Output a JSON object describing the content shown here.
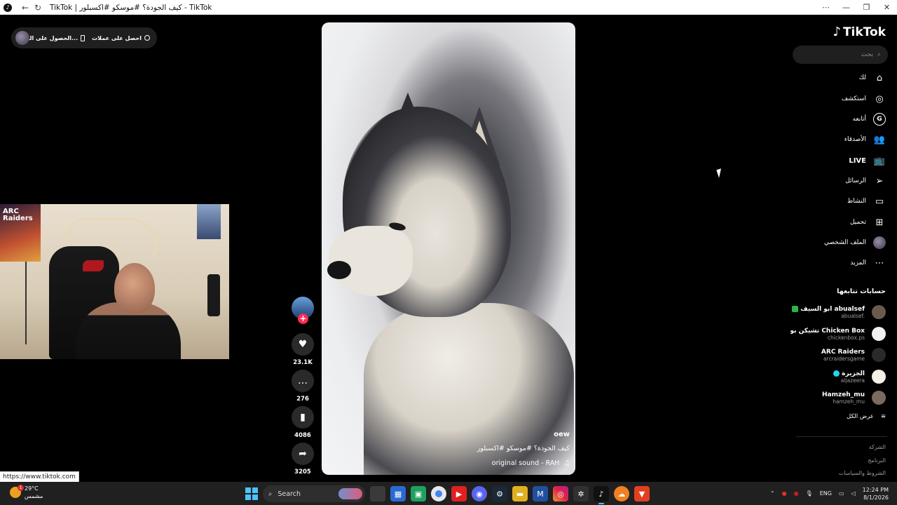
{
  "titlebar": {
    "title": "TikTok | كيف الجودة؟ #موسكو #اكسبلور - TikTok",
    "back_icon": "←",
    "reload_icon": "↻",
    "win_buttons": [
      "⋯",
      "—",
      "❐",
      "✕"
    ]
  },
  "coins_pill": {
    "get_coins": "احصل على عملات",
    "get_app": "الحصول على الت..."
  },
  "logo": {
    "text": "TikTok"
  },
  "search": {
    "placeholder": "بحث"
  },
  "nav": [
    {
      "label": "لك",
      "icon": "home-icon"
    },
    {
      "label": "استكشف",
      "icon": "compass-icon"
    },
    {
      "label": "أتابعه",
      "icon": "following-badge-icon"
    },
    {
      "label": "الأصدقاء",
      "icon": "friends-icon"
    },
    {
      "label": "LIVE",
      "icon": "live-tv-icon"
    },
    {
      "label": "الرسائل",
      "icon": "send-icon"
    },
    {
      "label": "النشاط",
      "icon": "activity-icon"
    },
    {
      "label": "تحميل",
      "icon": "upload-icon"
    },
    {
      "label": "الملف الشخصي",
      "icon": "profile-avatar"
    },
    {
      "label": "المزيد",
      "icon": "more-icon"
    }
  ],
  "following": {
    "title": "حسابات تتابعها",
    "accounts": [
      {
        "name": "ابو السيف abualsef",
        "handle": "abualsef.",
        "verified": "green",
        "avatar_color": "#6a5a50"
      },
      {
        "name": "تشيكن بوكس Chicken Box",
        "handle": "chickenbox.ps",
        "verified": "",
        "avatar_color": "#f2f2f2"
      },
      {
        "name": "ARC Raiders",
        "handle": "arcraidersgame",
        "verified": "",
        "avatar_color": "#2a2a2a"
      },
      {
        "name": "الجزيرة",
        "handle": "aljazeera",
        "verified": "blue",
        "avatar_color": "#f5f0e6"
      },
      {
        "name": "Hamzeh_mu",
        "handle": "hamzeh_mu",
        "verified": "",
        "avatar_color": "#7a6a60"
      }
    ],
    "see_all": "عرض الكل"
  },
  "footer_links": [
    "الشركة",
    "البرنامج",
    "الشروط والسياسات"
  ],
  "video": {
    "username": "oew",
    "caption": "كيف الجودة؟ #موسكو #اكسبلور",
    "sound": "original sound - RAH"
  },
  "actions": {
    "likes": "23.1K",
    "comments": "276",
    "bookmarks": "4086",
    "shares": "3205"
  },
  "webcam": {
    "poster_text": "ARC Raiders"
  },
  "status_url": "https://www.tiktok.com",
  "taskbar": {
    "temperature": "29°C",
    "weather": "مشمس",
    "search": "Search",
    "lang": "ENG",
    "time": "12:24 PM",
    "date": "8/1/2026"
  },
  "colors": {
    "accent": "#fe2c55",
    "verified_blue": "#20d5ec",
    "verified_green": "#25b846",
    "windows_blue": "#4cc2ff"
  }
}
